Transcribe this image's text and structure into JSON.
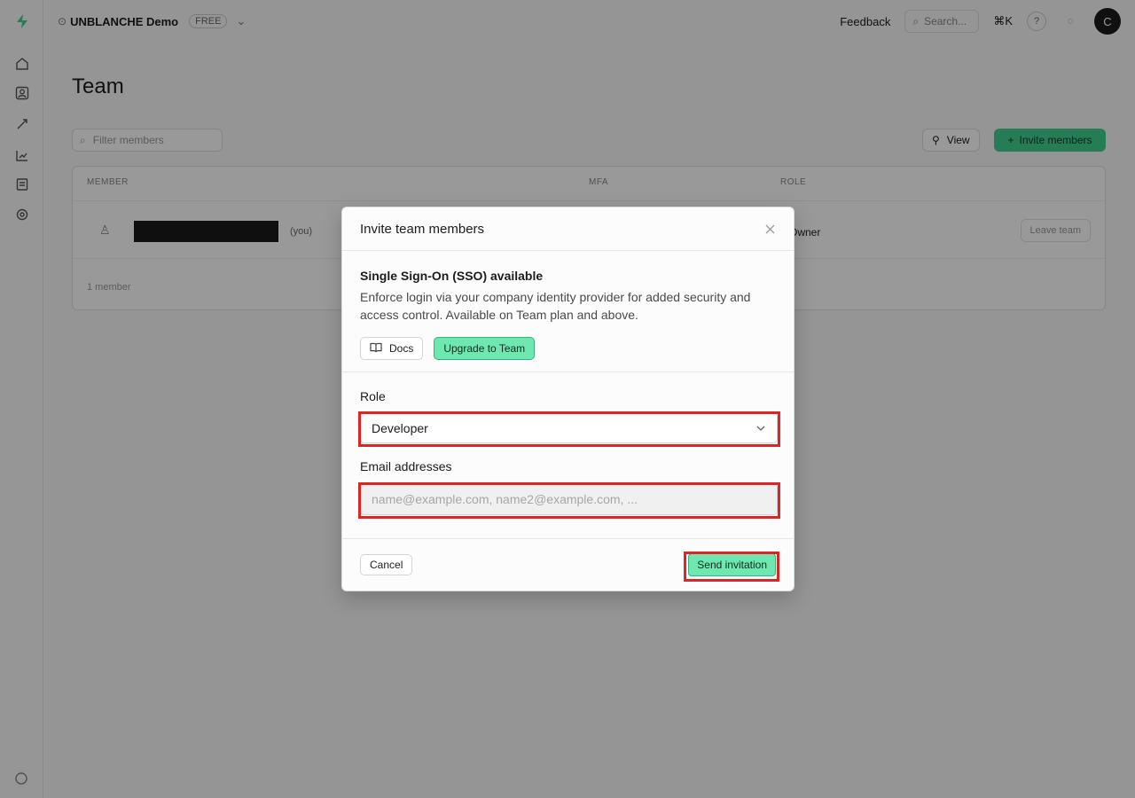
{
  "background": {
    "project_name": "UNBLANCHE Demo",
    "project_badge": "FREE",
    "feedback_label": "Feedback",
    "search_placeholder": "Search...",
    "search_shortcut": "⌘K",
    "avatar_initial": "C",
    "page_title": "Team",
    "filter_placeholder": "Filter members",
    "view_label": "View",
    "invite_label": "Invite members",
    "columns": [
      "MEMBER",
      "MFA",
      "ROLE"
    ],
    "member_suffix": "(you)",
    "member_role": "Owner",
    "leave_label": "Leave team",
    "members_count": "1 member"
  },
  "modal": {
    "title": "Invite team members",
    "sso_title": "Single Sign-On (SSO) available",
    "sso_description": "Enforce login via your company identity provider for added security and access control. Available on Team plan and above.",
    "docs_label": "Docs",
    "upgrade_label": "Upgrade to Team",
    "role_label": "Role",
    "role_value": "Developer",
    "email_label": "Email addresses",
    "email_placeholder": "name@example.com, name2@example.com, ...",
    "email_value": "",
    "cancel_label": "Cancel",
    "send_label": "Send invitation"
  },
  "colors": {
    "brand_green": "#3ecf8e",
    "button_green": "#6ee7b0",
    "highlight_red": "#dc2626"
  }
}
